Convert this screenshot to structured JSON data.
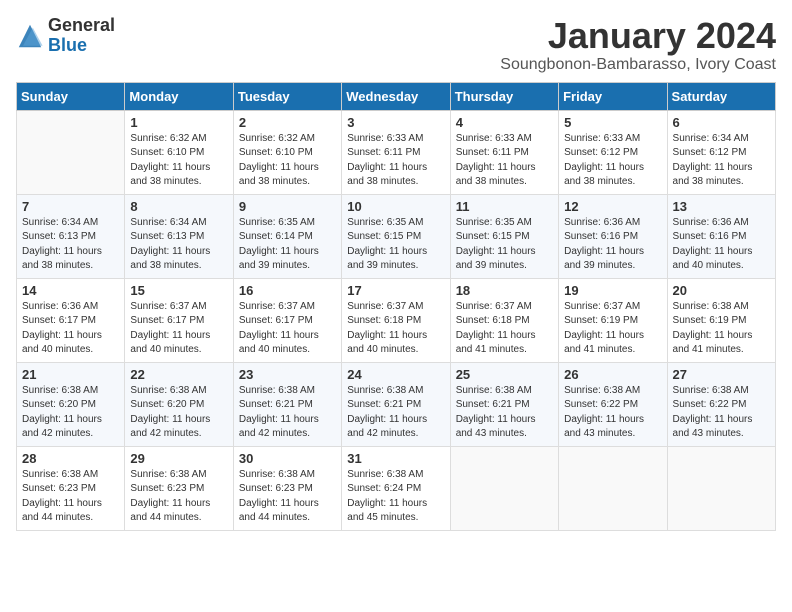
{
  "header": {
    "logo_general": "General",
    "logo_blue": "Blue",
    "title": "January 2024",
    "subtitle": "Soungbonon-Bambarasso, Ivory Coast"
  },
  "calendar": {
    "weekdays": [
      "Sunday",
      "Monday",
      "Tuesday",
      "Wednesday",
      "Thursday",
      "Friday",
      "Saturday"
    ],
    "weeks": [
      [
        {
          "day": "",
          "info": ""
        },
        {
          "day": "1",
          "info": "Sunrise: 6:32 AM\nSunset: 6:10 PM\nDaylight: 11 hours\nand 38 minutes."
        },
        {
          "day": "2",
          "info": "Sunrise: 6:32 AM\nSunset: 6:10 PM\nDaylight: 11 hours\nand 38 minutes."
        },
        {
          "day": "3",
          "info": "Sunrise: 6:33 AM\nSunset: 6:11 PM\nDaylight: 11 hours\nand 38 minutes."
        },
        {
          "day": "4",
          "info": "Sunrise: 6:33 AM\nSunset: 6:11 PM\nDaylight: 11 hours\nand 38 minutes."
        },
        {
          "day": "5",
          "info": "Sunrise: 6:33 AM\nSunset: 6:12 PM\nDaylight: 11 hours\nand 38 minutes."
        },
        {
          "day": "6",
          "info": "Sunrise: 6:34 AM\nSunset: 6:12 PM\nDaylight: 11 hours\nand 38 minutes."
        }
      ],
      [
        {
          "day": "7",
          "info": "Sunrise: 6:34 AM\nSunset: 6:13 PM\nDaylight: 11 hours\nand 38 minutes."
        },
        {
          "day": "8",
          "info": "Sunrise: 6:34 AM\nSunset: 6:13 PM\nDaylight: 11 hours\nand 38 minutes."
        },
        {
          "day": "9",
          "info": "Sunrise: 6:35 AM\nSunset: 6:14 PM\nDaylight: 11 hours\nand 39 minutes."
        },
        {
          "day": "10",
          "info": "Sunrise: 6:35 AM\nSunset: 6:15 PM\nDaylight: 11 hours\nand 39 minutes."
        },
        {
          "day": "11",
          "info": "Sunrise: 6:35 AM\nSunset: 6:15 PM\nDaylight: 11 hours\nand 39 minutes."
        },
        {
          "day": "12",
          "info": "Sunrise: 6:36 AM\nSunset: 6:16 PM\nDaylight: 11 hours\nand 39 minutes."
        },
        {
          "day": "13",
          "info": "Sunrise: 6:36 AM\nSunset: 6:16 PM\nDaylight: 11 hours\nand 40 minutes."
        }
      ],
      [
        {
          "day": "14",
          "info": "Sunrise: 6:36 AM\nSunset: 6:17 PM\nDaylight: 11 hours\nand 40 minutes."
        },
        {
          "day": "15",
          "info": "Sunrise: 6:37 AM\nSunset: 6:17 PM\nDaylight: 11 hours\nand 40 minutes."
        },
        {
          "day": "16",
          "info": "Sunrise: 6:37 AM\nSunset: 6:17 PM\nDaylight: 11 hours\nand 40 minutes."
        },
        {
          "day": "17",
          "info": "Sunrise: 6:37 AM\nSunset: 6:18 PM\nDaylight: 11 hours\nand 40 minutes."
        },
        {
          "day": "18",
          "info": "Sunrise: 6:37 AM\nSunset: 6:18 PM\nDaylight: 11 hours\nand 41 minutes."
        },
        {
          "day": "19",
          "info": "Sunrise: 6:37 AM\nSunset: 6:19 PM\nDaylight: 11 hours\nand 41 minutes."
        },
        {
          "day": "20",
          "info": "Sunrise: 6:38 AM\nSunset: 6:19 PM\nDaylight: 11 hours\nand 41 minutes."
        }
      ],
      [
        {
          "day": "21",
          "info": "Sunrise: 6:38 AM\nSunset: 6:20 PM\nDaylight: 11 hours\nand 42 minutes."
        },
        {
          "day": "22",
          "info": "Sunrise: 6:38 AM\nSunset: 6:20 PM\nDaylight: 11 hours\nand 42 minutes."
        },
        {
          "day": "23",
          "info": "Sunrise: 6:38 AM\nSunset: 6:21 PM\nDaylight: 11 hours\nand 42 minutes."
        },
        {
          "day": "24",
          "info": "Sunrise: 6:38 AM\nSunset: 6:21 PM\nDaylight: 11 hours\nand 42 minutes."
        },
        {
          "day": "25",
          "info": "Sunrise: 6:38 AM\nSunset: 6:21 PM\nDaylight: 11 hours\nand 43 minutes."
        },
        {
          "day": "26",
          "info": "Sunrise: 6:38 AM\nSunset: 6:22 PM\nDaylight: 11 hours\nand 43 minutes."
        },
        {
          "day": "27",
          "info": "Sunrise: 6:38 AM\nSunset: 6:22 PM\nDaylight: 11 hours\nand 43 minutes."
        }
      ],
      [
        {
          "day": "28",
          "info": "Sunrise: 6:38 AM\nSunset: 6:23 PM\nDaylight: 11 hours\nand 44 minutes."
        },
        {
          "day": "29",
          "info": "Sunrise: 6:38 AM\nSunset: 6:23 PM\nDaylight: 11 hours\nand 44 minutes."
        },
        {
          "day": "30",
          "info": "Sunrise: 6:38 AM\nSunset: 6:23 PM\nDaylight: 11 hours\nand 44 minutes."
        },
        {
          "day": "31",
          "info": "Sunrise: 6:38 AM\nSunset: 6:24 PM\nDaylight: 11 hours\nand 45 minutes."
        },
        {
          "day": "",
          "info": ""
        },
        {
          "day": "",
          "info": ""
        },
        {
          "day": "",
          "info": ""
        }
      ]
    ]
  }
}
